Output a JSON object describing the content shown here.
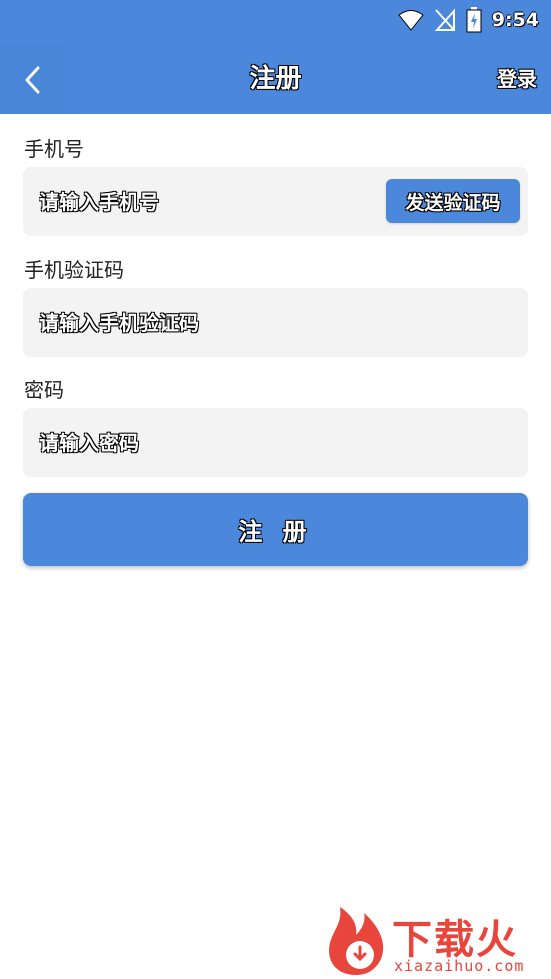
{
  "status_bar": {
    "time": "9:54"
  },
  "app_bar": {
    "title": "注册",
    "action": "登录"
  },
  "form": {
    "phone": {
      "label": "手机号",
      "placeholder": "请输入手机号",
      "send_code": "发送验证码"
    },
    "code": {
      "label": "手机验证码",
      "placeholder": "请输入手机验证码"
    },
    "password": {
      "label": "密码",
      "placeholder": "请输入密码"
    },
    "submit": "注 册"
  },
  "watermark": {
    "text": "下载火",
    "url": "xiazaihuo.com"
  },
  "colors": {
    "primary": "#4b88dc",
    "field_bg": "#f3f3f3",
    "watermark": "#e8453c"
  }
}
